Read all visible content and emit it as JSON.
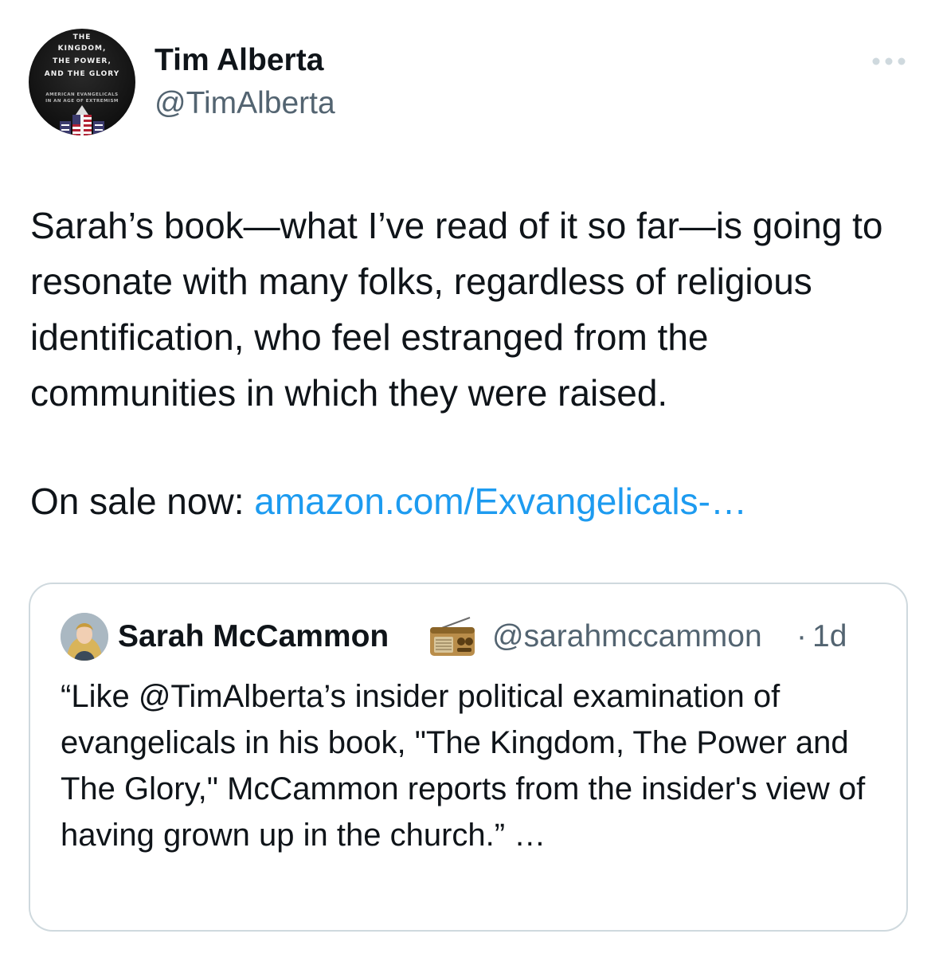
{
  "author": {
    "display_name": "Tim Alberta",
    "handle": "@TimAlberta",
    "avatar_icon": "book-cover-avatar",
    "avatar_cover_lettering": [
      "THE",
      "KINGDOM,",
      "THE POWER,",
      "AND THE GLORY",
      "AMERICAN EVANGELICALS",
      "IN AN AGE OF EXTREMISM"
    ]
  },
  "more_icon": "more-horizontal-icon",
  "tweet": {
    "paragraph": "Sarah’s book—what I’ve read of it so far—is going to resonate with many folks, regardless of religious identification, who feel estranged from the communities in which they were raised.",
    "sale_prefix": "On sale now: ",
    "link_text": "amazon.com/Exvangelicals-…"
  },
  "quote": {
    "display_name": "Sarah McCammon",
    "emoji_icon": "radio-icon",
    "handle": "@sarahmccammon",
    "separator": "·",
    "time": "1d",
    "text": "“Like @TimAlberta’s  insider political examination of evangelicals in his book, \"The Kingdom, The Power and The Glory,\" McCammon reports from the insider's view of having grown up in the church.” …"
  },
  "colors": {
    "text_primary": "#0f1419",
    "text_secondary": "#536471",
    "link": "#1d9bf0",
    "border": "#cfd9de"
  }
}
